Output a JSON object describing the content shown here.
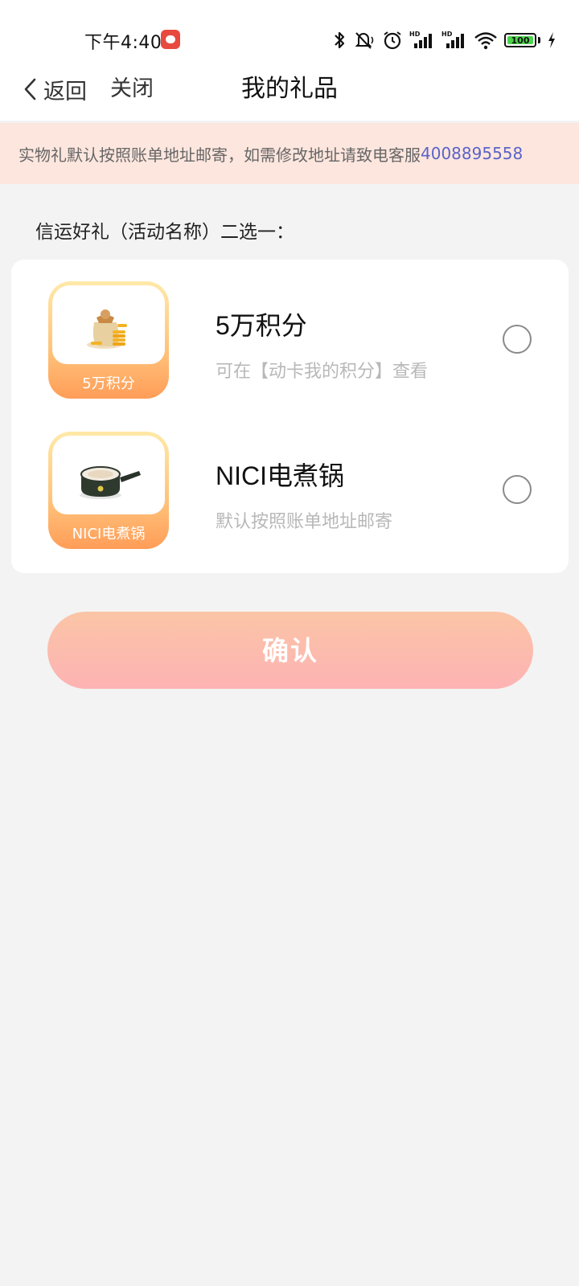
{
  "status_bar": {
    "time": "下午4:40",
    "battery": "100",
    "battery_level": 1.0,
    "app_icon": "app-notification-icon",
    "icons": [
      "bluetooth-icon",
      "mute-icon",
      "alarm-icon",
      "hd-signal-icon",
      "hd-signal-icon",
      "wifi-icon",
      "battery-icon",
      "charging-icon"
    ]
  },
  "nav": {
    "back_label": "返回",
    "close_label": "关闭",
    "title": "我的礼品"
  },
  "notice": {
    "text": "实物礼默认按照账单地址邮寄，如需修改地址请致电客服",
    "phone": "4008895558",
    "background": "#fde6de",
    "phone_color": "#5a63c8"
  },
  "section_label": "信运好礼（活动名称）二选一：",
  "gifts": [
    {
      "thumb_caption": "5万积分",
      "image": "coin-bag-image",
      "name": "5万积分",
      "desc": "可在【动卡我的积分】查看",
      "selected": false
    },
    {
      "thumb_caption": "NICI电煮锅",
      "image": "electric-pot-image",
      "name": "NICI电煮锅",
      "desc": "默认按照账单地址邮寄",
      "selected": false
    }
  ],
  "confirm_label": "确认",
  "colors": {
    "page_bg": "#f3f3f3",
    "button_gradient_top": "#fbc5a6",
    "button_gradient_bottom": "#fdb3b4",
    "thumb_gradient": "#ff9d58"
  }
}
